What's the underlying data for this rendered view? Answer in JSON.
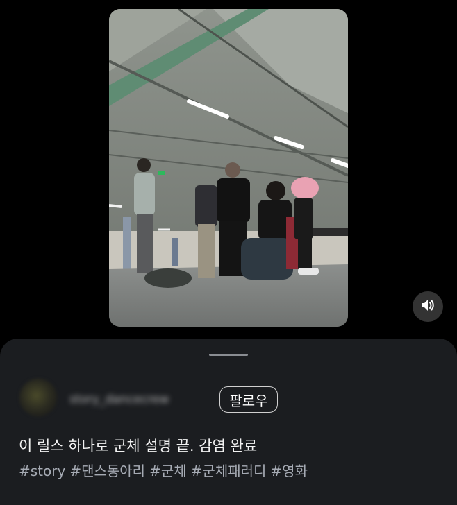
{
  "post": {
    "username": "story_dancecrew",
    "follow_label": "팔로우",
    "caption": "이 릴스 하나로 군체 설명 끝. 감염 완료",
    "hashtags": [
      "#story",
      "#댄스동아리",
      "#군체",
      "#군체패러디",
      "#영화"
    ]
  },
  "icons": {
    "mute": "speaker-icon"
  }
}
